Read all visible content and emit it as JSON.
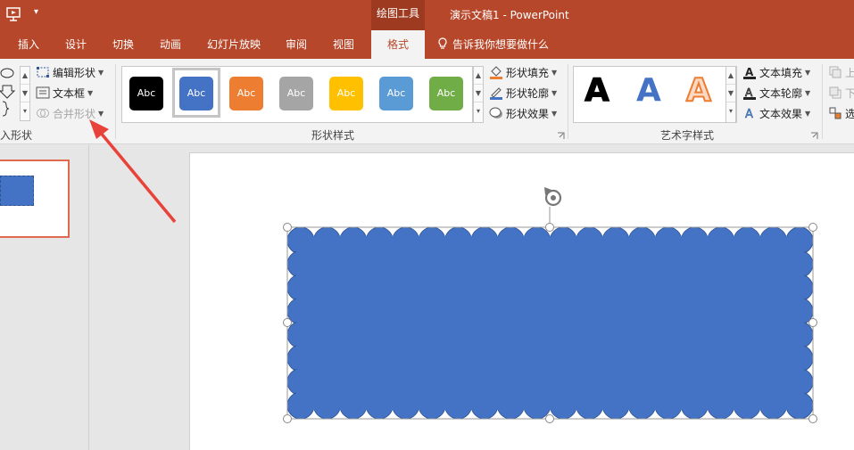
{
  "titlebar": {
    "qat_dropdown": "▾",
    "context_tools": "绘图工具",
    "document_title": "演示文稿1  -  PowerPoint"
  },
  "tabs": [
    {
      "label": "插入"
    },
    {
      "label": "设计"
    },
    {
      "label": "切换"
    },
    {
      "label": "动画"
    },
    {
      "label": "幻灯片放映"
    },
    {
      "label": "审阅"
    },
    {
      "label": "视图"
    },
    {
      "label": "格式"
    }
  ],
  "tellme": "告诉我你想要做什么",
  "ribbon": {
    "insert_shapes": {
      "label": "入形状",
      "edit_shape": "编辑形状",
      "text_box": "文本框",
      "merge_shapes": "合并形状"
    },
    "shape_styles": {
      "label": "形状样式",
      "swatches": [
        {
          "text": "Abc",
          "color": "#000000"
        },
        {
          "text": "Abc",
          "color": "#4472c4"
        },
        {
          "text": "Abc",
          "color": "#ed7d31"
        },
        {
          "text": "Abc",
          "color": "#a5a5a5"
        },
        {
          "text": "Abc",
          "color": "#ffc000"
        },
        {
          "text": "Abc",
          "color": "#5b9bd5"
        },
        {
          "text": "Abc",
          "color": "#70ad47"
        }
      ],
      "shape_fill": "形状填充",
      "shape_outline": "形状轮廓",
      "shape_effects": "形状效果"
    },
    "wordart_styles": {
      "label": "艺术字样式",
      "letters": [
        {
          "text": "A",
          "color": "#000000"
        },
        {
          "text": "A",
          "color": "#4472c4"
        },
        {
          "text": "A",
          "color": "#ed7d31"
        }
      ],
      "text_fill": "文本填充",
      "text_outline": "文本轮廓",
      "text_effects": "文本效果"
    },
    "arrange": {
      "bring_forward": "上",
      "send_backward": "下",
      "selection_pane": "选"
    }
  },
  "colors": {
    "accent": "#b7472a",
    "shape_fill": "#4472c4",
    "arrow": "#e8433b"
  }
}
